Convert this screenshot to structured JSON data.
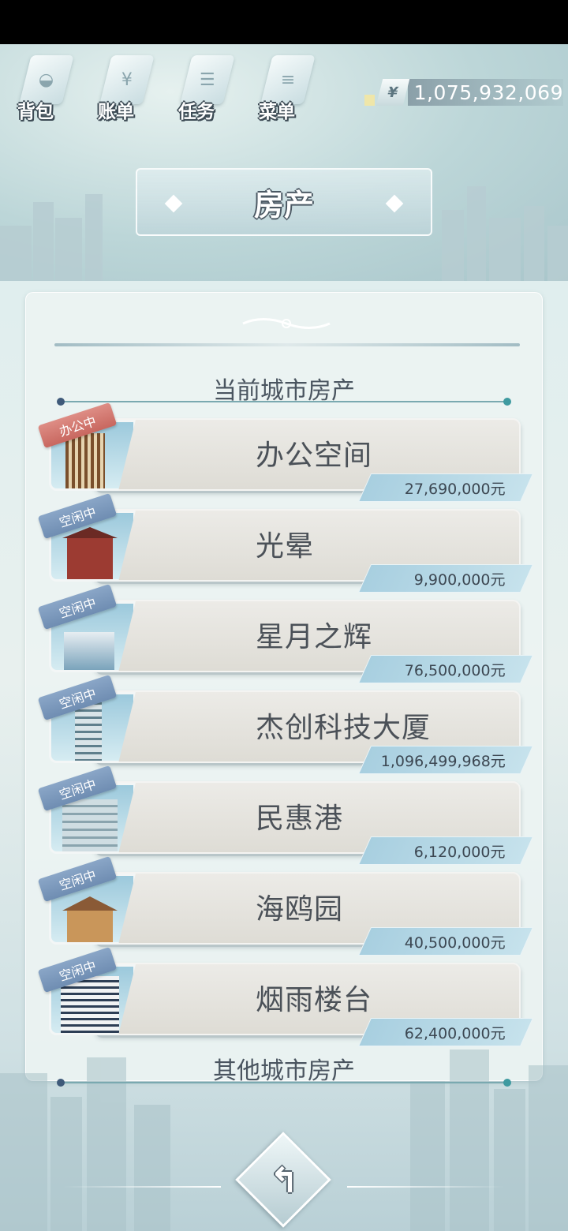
{
  "nav": [
    {
      "label": "背包",
      "icon": "bag-icon",
      "glyph": "◒"
    },
    {
      "label": "账单",
      "icon": "bill-icon",
      "glyph": "¥"
    },
    {
      "label": "任务",
      "icon": "task-icon",
      "glyph": "☰"
    },
    {
      "label": "菜单",
      "icon": "menu-icon",
      "glyph": "≡"
    }
  ],
  "money": {
    "symbol": "¥",
    "value": "1,075,932,069"
  },
  "title": "房产",
  "section_current": "当前城市房产",
  "section_other": "其他城市房产",
  "properties": [
    {
      "name": "办公空间",
      "price": "27,690,000元",
      "status": "办公中",
      "status_type": "office"
    },
    {
      "name": "光晕",
      "price": "9,900,000元",
      "status": "空闲中",
      "status_type": "idle"
    },
    {
      "name": "星月之辉",
      "price": "76,500,000元",
      "status": "空闲中",
      "status_type": "idle"
    },
    {
      "name": "杰创科技大厦",
      "price": "1,096,499,968元",
      "status": "空闲中",
      "status_type": "idle"
    },
    {
      "name": "民惠港",
      "price": "6,120,000元",
      "status": "空闲中",
      "status_type": "idle"
    },
    {
      "name": "海鸥园",
      "price": "40,500,000元",
      "status": "空闲中",
      "status_type": "idle"
    },
    {
      "name": "烟雨楼台",
      "price": "62,400,000元",
      "status": "空闲中",
      "status_type": "idle"
    }
  ],
  "back": {
    "glyph": "↰",
    "icon": "back-arrow-icon"
  },
  "colors": {
    "accent": "#a8cfe0",
    "office_tag": "#c8675f",
    "idle_tag": "#6f8db2",
    "text": "#4b5158"
  }
}
